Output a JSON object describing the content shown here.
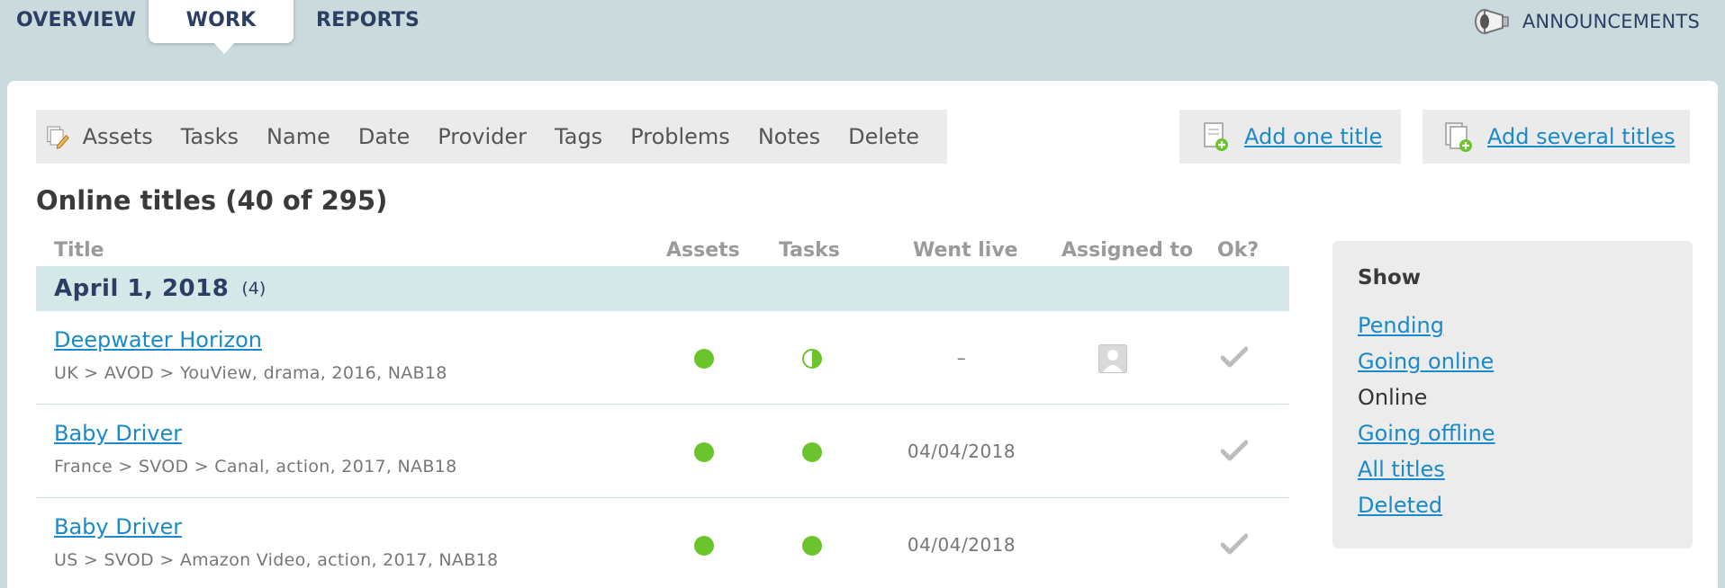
{
  "nav": {
    "tabs": [
      {
        "label": "OVERVIEW"
      },
      {
        "label": "WORK"
      },
      {
        "label": "REPORTS"
      }
    ],
    "announcements_label": "ANNOUNCEMENTS"
  },
  "toolbar": {
    "items": [
      "Assets",
      "Tasks",
      "Name",
      "Date",
      "Provider",
      "Tags",
      "Problems",
      "Notes",
      "Delete"
    ]
  },
  "actions": {
    "add_one": "Add one title",
    "add_several": "Add several titles"
  },
  "section_title": "Online titles (40 of 295)",
  "table": {
    "headers": {
      "title": "Title",
      "assets": "Assets",
      "tasks": "Tasks",
      "went_live": "Went live",
      "assigned_to": "Assigned to",
      "ok": "Ok?"
    },
    "group": {
      "date": "April 1, 2018",
      "count": "(4)"
    },
    "rows": [
      {
        "title": "Deepwater Horizon",
        "meta": "UK > AVOD > YouView, drama, 2016, NAB18",
        "assets_status": "complete",
        "tasks_status": "partial",
        "went_live": "–"
      },
      {
        "title": "Baby Driver",
        "meta": "France > SVOD > Canal, action, 2017, NAB18",
        "assets_status": "complete",
        "tasks_status": "complete",
        "went_live": "04/04/2018"
      },
      {
        "title": "Baby Driver",
        "meta": "US > SVOD > Amazon Video, action, 2017, NAB18",
        "assets_status": "complete",
        "tasks_status": "complete",
        "went_live": "04/04/2018"
      }
    ]
  },
  "show_filter": {
    "title": "Show",
    "items": [
      "Pending",
      "Going online",
      "Online",
      "Going offline",
      "All titles",
      "Deleted"
    ],
    "current": "Online"
  },
  "colors": {
    "nav_text": "#2b3f63",
    "link": "#1a8ac8",
    "status_green": "#6bc42c",
    "group_bg": "#d6e7e9",
    "page_bg": "#cbdadc"
  },
  "icons": {
    "announcements": "megaphone-icon",
    "toolbar": "edit-documents-icon",
    "add_one": "add-document-icon",
    "add_several": "add-documents-icon",
    "assigned": "user-placeholder-icon",
    "ok": "checkmark-icon"
  }
}
